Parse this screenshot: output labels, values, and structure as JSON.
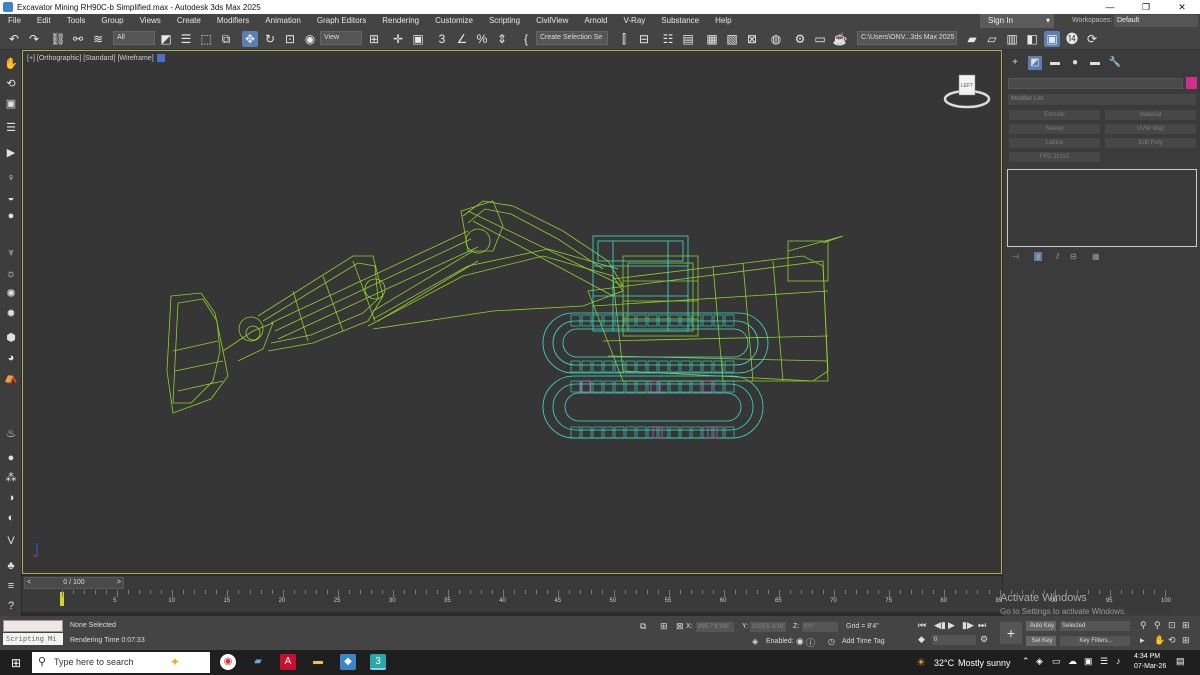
{
  "window": {
    "title": "Excavator Mining RH90C-b Simplified.max - Autodesk 3ds Max 2025",
    "controls": [
      "—",
      "❐",
      "✕"
    ]
  },
  "menu": [
    "File",
    "Edit",
    "Tools",
    "Group",
    "Views",
    "Create",
    "Modifiers",
    "Animation",
    "Graph Editors",
    "Rendering",
    "Customize",
    "Scripting",
    "CivilView",
    "Arnold",
    "V-Ray",
    "Substance",
    "Help"
  ],
  "account": {
    "signin": "Sign In",
    "workspaces_label": "Workspaces:",
    "workspace": "Default"
  },
  "toolbar": {
    "filter": "All",
    "ref_coord": "View",
    "selection_set": "Create Selection Se",
    "project_path": "C:\\Users\\ONV...3ds Max 2025"
  },
  "viewport": {
    "label": "[+] [Orthographic] [Standard] [Wireframe]",
    "navcube_face": "LEFT",
    "colors": {
      "boom": "#8fd12a",
      "tracks": "#3fe0c8",
      "selected": "#c060c0"
    }
  },
  "command_panel": {
    "modifier_list": "Modifier List",
    "buttons": [
      "Extrude",
      "Material",
      "Sweep",
      "UVW Map",
      "Lattice",
      "Edit Poly",
      "FFD 2x2x2"
    ]
  },
  "timeline": {
    "frame": "0 / 100",
    "ticks": [
      "5",
      "10",
      "15",
      "20",
      "25",
      "30",
      "35",
      "40",
      "45",
      "50",
      "55",
      "60",
      "65",
      "70",
      "75",
      "80",
      "85",
      "90",
      "95",
      "100"
    ]
  },
  "status": {
    "selection": "None Selected",
    "render_time": "Rendering Time  0:07:33",
    "script_label": "Scripting Mi",
    "x_label": "X:",
    "x_value": "895.7'3 3/8\"",
    "y_label": "Y:",
    "y_value": "1025'5 1/16\"",
    "z_label": "Z:",
    "z_value": "0'0\"",
    "grid": "Grid = 8'4\"",
    "enabled": "Enabled:",
    "add_time_tag": "Add Time Tag",
    "auto_key": "Auto Key",
    "set_key": "Set Key",
    "key_mode": "Selected",
    "key_filters": "Key Filters...",
    "current_frame": "0"
  },
  "watermark": {
    "line1": "Activate Windows",
    "line2": "Go to Settings to activate Windows."
  },
  "taskbar": {
    "search_placeholder": "Type here to search",
    "weather_temp": "32°C",
    "weather_desc": "Mostly sunny",
    "time": "4:34 PM",
    "date": "07-Mar-26"
  }
}
